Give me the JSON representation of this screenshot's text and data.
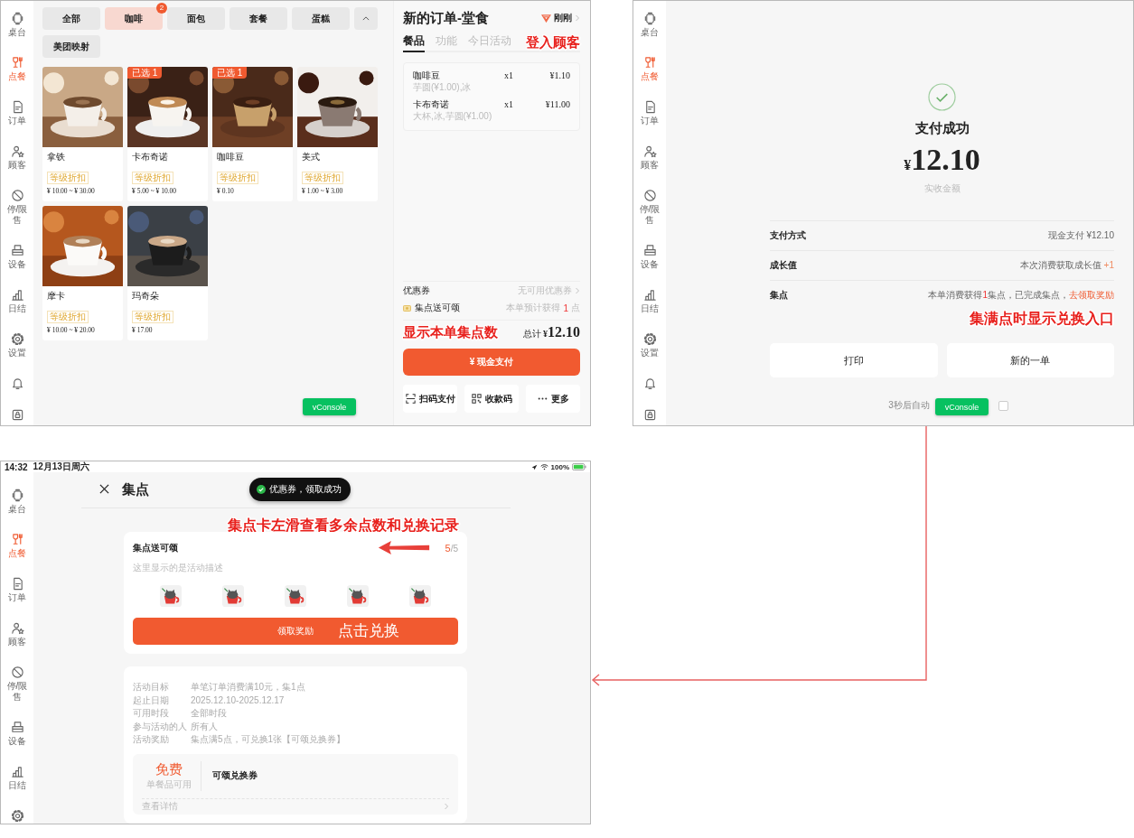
{
  "order_screen": {
    "sidebar": [
      {
        "kind": "table",
        "label": "桌台",
        "selected": false
      },
      {
        "kind": "dine",
        "label": "点餐",
        "selected": true
      },
      {
        "kind": "order",
        "label": "订单",
        "selected": false
      },
      {
        "kind": "customer",
        "label": "顾客",
        "selected": false
      },
      {
        "kind": "stop",
        "label": "停/限售",
        "selected": false
      },
      {
        "kind": "device",
        "label": "设备",
        "selected": false
      },
      {
        "kind": "daily",
        "label": "日结",
        "selected": false
      },
      {
        "kind": "settings",
        "label": "设置",
        "selected": false
      },
      {
        "kind": "bell",
        "selected": false
      },
      {
        "kind": "lock",
        "selected": false
      }
    ],
    "categories": [
      {
        "label": "全部",
        "selected": false
      },
      {
        "label": "咖啡",
        "selected": true,
        "badge": "2"
      },
      {
        "label": "面包",
        "selected": false
      },
      {
        "label": "套餐",
        "selected": false
      },
      {
        "label": "蛋糕",
        "selected": false
      },
      {
        "label": "美团映射",
        "selected": false
      }
    ],
    "products": [
      {
        "name": "拿铁",
        "tag": "等级折扣",
        "price": "¥ 10.00 ~ ¥ 30.00"
      },
      {
        "name": "卡布奇诺",
        "picked": "已选 1",
        "tag": "等级折扣",
        "price": "¥ 5.00 ~ ¥ 10.00"
      },
      {
        "name": "咖啡豆",
        "picked": "已选 1",
        "tag": "等级折扣",
        "price": "¥ 0.10"
      },
      {
        "name": "美式",
        "tag": "等级折扣",
        "price": "¥ 1.00 ~ ¥ 3.00"
      },
      {
        "name": "摩卡",
        "tag": "等级折扣",
        "price": "¥ 10.00 ~ ¥ 20.00"
      },
      {
        "name": "玛奇朵",
        "tag": "等级折扣",
        "price": "¥ 17.00"
      }
    ],
    "vconsole": "vConsole",
    "order": {
      "title": "新的订单-堂食",
      "time": "刚刚",
      "tabs": [
        {
          "label": "餐品",
          "selected": true
        },
        {
          "label": "功能",
          "selected": false
        },
        {
          "label": "今日活动",
          "selected": false
        }
      ],
      "annotation": "登入顾客",
      "items": [
        {
          "name": "咖啡豆",
          "quantity": "x1",
          "price": "¥1.10",
          "options": "芋圆(¥1.00),冰"
        },
        {
          "name": "卡布奇诺",
          "quantity": "x1",
          "price": "¥11.00",
          "options": "大杯,冰,芋圆(¥1.00)"
        }
      ],
      "coupon_label": "优惠券",
      "coupon_value": "无可用优惠券",
      "stamp_label": "集点送可颂",
      "stamp_estimate": [
        {
          "kind": "text",
          "text": "本单预计获得"
        },
        {
          "kind": "count",
          "text": "1"
        },
        {
          "kind": "text",
          "text": "点"
        }
      ],
      "total_annotation": "显示本单集点数",
      "total_label": "总计",
      "currency": "¥",
      "total": "12.10",
      "pay_button": "¥ 现金支付",
      "actions": [
        {
          "kind": "scan",
          "label": "扫码支付"
        },
        {
          "kind": "qr",
          "label": "收款码"
        },
        {
          "kind": "more",
          "label": "更多"
        }
      ]
    }
  },
  "success_screen": {
    "sidebar": [
      {
        "kind": "table",
        "label": "桌台",
        "selected": false
      },
      {
        "kind": "dine",
        "label": "点餐",
        "selected": true
      },
      {
        "kind": "order",
        "label": "订单",
        "selected": false
      },
      {
        "kind": "customer",
        "label": "顾客",
        "selected": false
      },
      {
        "kind": "stop",
        "label": "停/限售",
        "selected": false
      },
      {
        "kind": "device",
        "label": "设备",
        "selected": false
      },
      {
        "kind": "daily",
        "label": "日结",
        "selected": false
      },
      {
        "kind": "settings",
        "label": "设置",
        "selected": false
      },
      {
        "kind": "bell",
        "selected": false
      },
      {
        "kind": "lock",
        "selected": false
      }
    ],
    "title": "支付成功",
    "currency": "¥",
    "amount": "12.10",
    "amount_label": "实收金额",
    "rows": [
      {
        "label": "支付方式",
        "value": [
          {
            "kind": "text",
            "text": "现金支付 ¥12.10"
          }
        ]
      },
      {
        "label": "成长值",
        "value": [
          {
            "kind": "text",
            "text": "本次消费获取成长值 "
          },
          {
            "kind": "plus",
            "text": "+1"
          }
        ]
      },
      {
        "label": "集点",
        "value": [
          {
            "kind": "text",
            "text": "本单消费获得"
          },
          {
            "kind": "count",
            "text": "1"
          },
          {
            "kind": "text",
            "text": "集点，已完成集点，"
          },
          {
            "kind": "link",
            "text": "去领取奖励"
          }
        ]
      }
    ],
    "annotation": "集满点时显示兑换入口",
    "buttons": [
      "打印",
      "新的一单"
    ],
    "countdown": "3秒后自动",
    "auto_checked": false,
    "vconsole": "vConsole"
  },
  "stamp_screen": {
    "status_bar": {
      "time": "14:32",
      "date": "12月13日周六",
      "battery": "100%"
    },
    "sidebar": [
      {
        "kind": "table",
        "label": "桌台",
        "selected": false
      },
      {
        "kind": "dine",
        "label": "点餐",
        "selected": true
      },
      {
        "kind": "order",
        "label": "订单",
        "selected": false
      },
      {
        "kind": "customer",
        "label": "顾客",
        "selected": false
      },
      {
        "kind": "stop",
        "label": "停/限售",
        "selected": false
      },
      {
        "kind": "device",
        "label": "设备",
        "selected": false
      },
      {
        "kind": "daily",
        "label": "日结",
        "selected": false
      },
      {
        "kind": "settings",
        "selected": false
      }
    ],
    "title": "集点",
    "toast": "优惠券，领取成功",
    "annotation": "集点卡左滑查看多余点数和兑换记录",
    "card": {
      "name": "集点送可颂",
      "done": "5",
      "total": "/5",
      "description": "这里显示的是活动描述",
      "stamps": [
        {
          "collected": true
        },
        {
          "collected": true
        },
        {
          "collected": true
        },
        {
          "collected": true
        },
        {
          "collected": true
        }
      ],
      "claim_button": "领取奖励",
      "claim_annotation": "点击兑换"
    },
    "details": [
      {
        "label": "活动目标",
        "value": "单笔订单消费满10元，集1点"
      },
      {
        "label": "起止日期",
        "value": "2025.12.10-2025.12.17"
      },
      {
        "label": "可用时段",
        "value": "全部时段"
      },
      {
        "label": "参与活动的人",
        "value": "所有人"
      },
      {
        "label": "活动奖励",
        "value": "集点满5点，可兑换1张【可颂兑换券】"
      }
    ],
    "coupon": {
      "amount": "免费",
      "scope": "单餐品可用",
      "name": "可颂兑换券",
      "details_link": "查看详情"
    }
  }
}
